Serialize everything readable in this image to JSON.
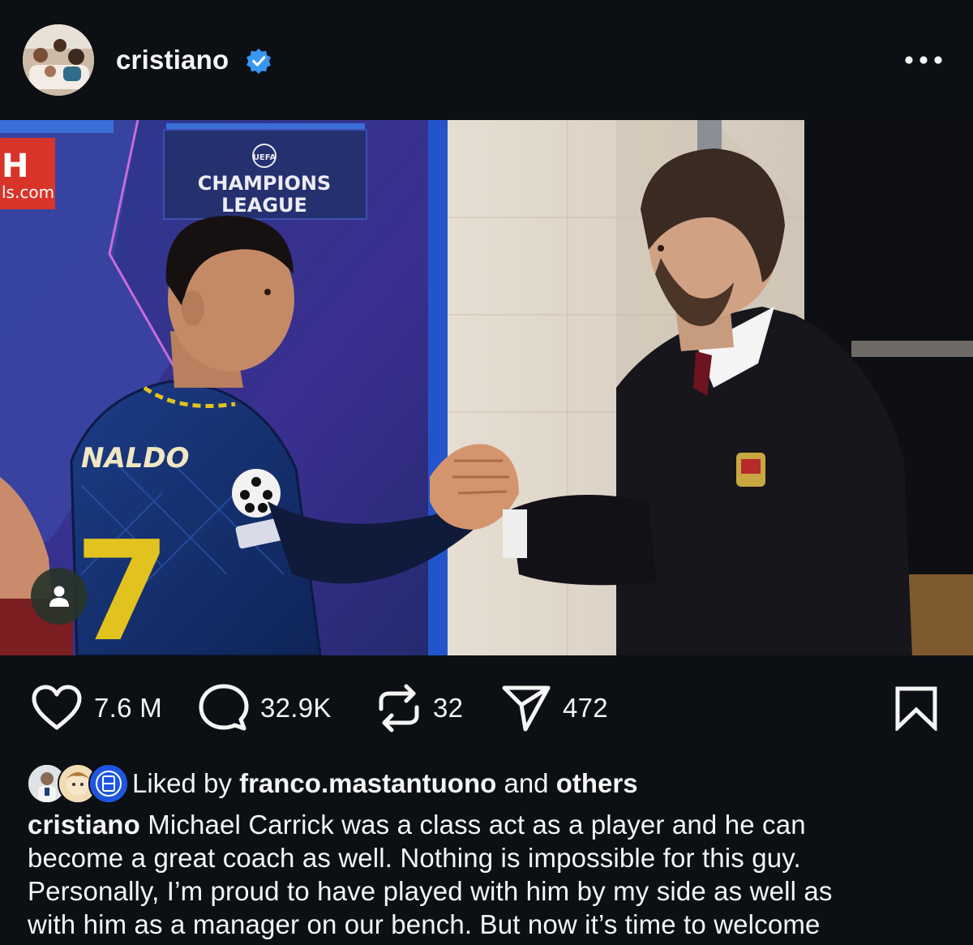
{
  "post": {
    "username": "cristiano",
    "verified_icon": "verified-badge-icon",
    "more_icon": "more-options-icon",
    "photo_signage": {
      "sponsor_fragment_1": "H",
      "sponsor_fragment_2": "ls.com",
      "competition_line_1": "UEFA",
      "competition_line_2": "CHAMPIONS",
      "competition_line_3": "LEAGUE",
      "jersey_name": "NALDO",
      "jersey_number": "7"
    },
    "tag_icon": "user-tag-icon"
  },
  "actions": {
    "likes": "7.6 M",
    "comments": "32.9K",
    "reposts": "32",
    "shares": "472"
  },
  "liked_by": {
    "prefix": "Liked by",
    "user": "franco.mastantuono",
    "middle": "and",
    "others": "others"
  },
  "caption": {
    "username": "cristiano",
    "line_1": "Michael Carrick was a class act as a player and he can",
    "line_2": "become a great coach as well. Nothing is impossible for this guy.",
    "line_3": "Personally, I’m proud to have played with him by my side as well as",
    "line_4": "with him as a manager on our bench. But now it’s time to welcome"
  },
  "colors": {
    "background": "#0c1014",
    "text": "#f5f5f5",
    "verified": "#3897f0"
  }
}
